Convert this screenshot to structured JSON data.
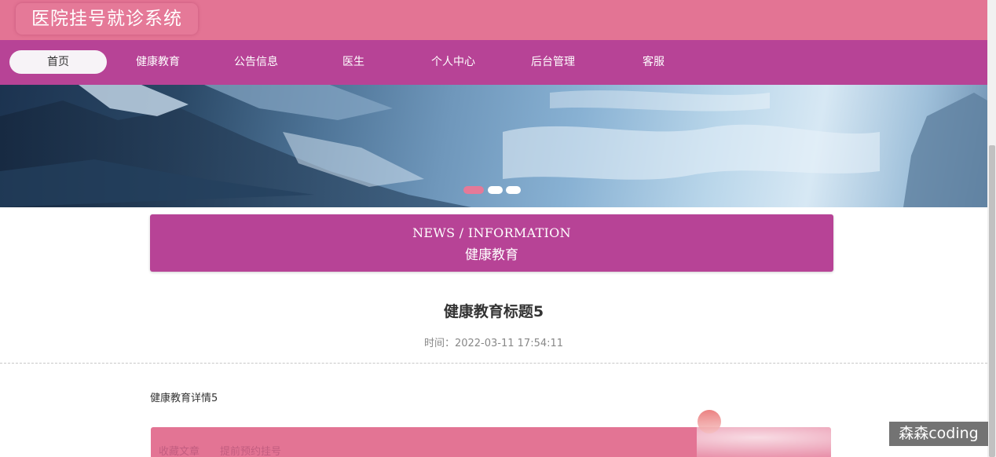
{
  "header": {
    "site_title": "医院挂号就诊系统"
  },
  "nav": {
    "items": [
      {
        "label": "首页",
        "active": true
      },
      {
        "label": "健康教育"
      },
      {
        "label": "公告信息"
      },
      {
        "label": "医生"
      },
      {
        "label": "个人中心"
      },
      {
        "label": "后台管理"
      },
      {
        "label": "客服"
      }
    ]
  },
  "banner": {
    "slide_count": 3,
    "active_slide": 1
  },
  "section": {
    "en_title": "NEWS / INFORMATION",
    "cn_title": "健康教育"
  },
  "article": {
    "title": "健康教育标题5",
    "time_label": "时间：",
    "time_value": "2022-03-11 17:54:11",
    "body": "健康教育详情5"
  },
  "bottom_bar": {
    "text": "收藏文章　　提前预约挂号"
  },
  "watermark": {
    "text": "森森coding"
  },
  "colors": {
    "header": "#e37494",
    "nav": "#b74396",
    "accent": "#e57998"
  }
}
